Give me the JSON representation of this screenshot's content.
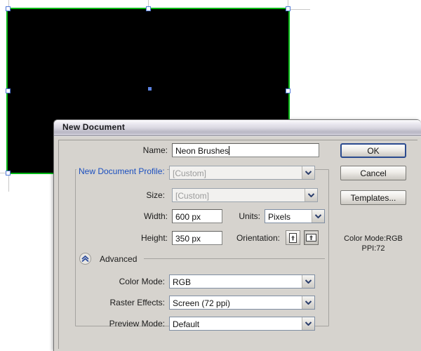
{
  "canvas": {
    "artboard": {
      "fill_color": "#000000",
      "selection_outline_color": "#00b514",
      "handle_color": "#4f77d8",
      "center_point_color": "#5c82e0"
    },
    "background_color": "#ffffff",
    "guide_color": "#c8c8c8"
  },
  "dialog": {
    "title": "New Document",
    "name": {
      "label": "Name:",
      "value": "Neon Brushes"
    },
    "profile": {
      "label": "New Document Profile:",
      "value": "[Custom]",
      "label_color": "#1b4fbf"
    },
    "size": {
      "label": "Size:",
      "value": "[Custom]"
    },
    "width": {
      "label": "Width:",
      "value": "600 px"
    },
    "units": {
      "label": "Units:",
      "value": "Pixels"
    },
    "height": {
      "label": "Height:",
      "value": "350 px"
    },
    "orientation": {
      "label": "Orientation:",
      "portrait_icon": "portrait-orientation-icon",
      "landscape_icon": "landscape-orientation-icon",
      "selected": "landscape"
    },
    "advanced": {
      "label": "Advanced",
      "toggle_icon": "chevron-double-up-icon",
      "expanded": true
    },
    "color_mode": {
      "label": "Color Mode:",
      "value": "RGB"
    },
    "raster_effects": {
      "label": "Raster Effects:",
      "value": "Screen (72 ppi)"
    },
    "preview_mode": {
      "label": "Preview Mode:",
      "value": "Default"
    },
    "buttons": {
      "ok": "OK",
      "cancel": "Cancel",
      "templates": "Templates..."
    },
    "info": {
      "color_mode": "Color Mode:RGB",
      "ppi": "PPI:72"
    }
  }
}
